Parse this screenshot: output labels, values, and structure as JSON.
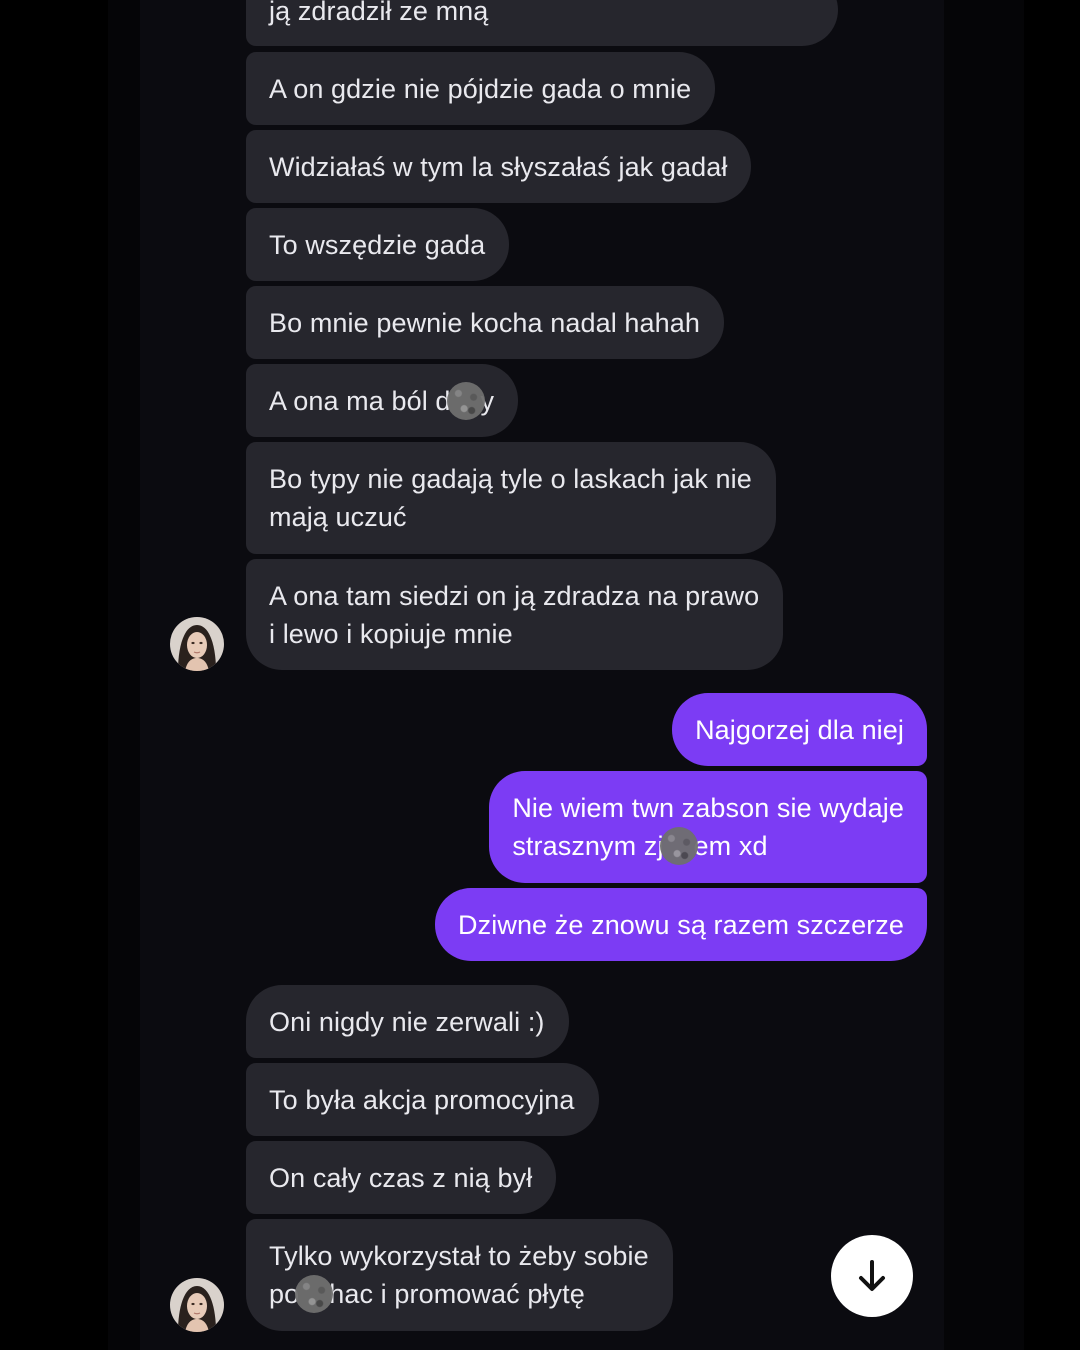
{
  "messages": {
    "m0": "ją zdradził ze mną",
    "m1": "A on gdzie nie pójdzie gada o mnie",
    "m2": "Widziałaś w tym la słyszałaś jak gadał",
    "m3": "To wszędzie gada",
    "m4": "Bo mnie pewnie kocha nadal hahah",
    "m5_a": "A ona ma ból d",
    "m5_b": "y",
    "m6_l1": "Bo typy nie gadają tyle o laskach jak nie",
    "m6_l2": "mają uczuć",
    "m7_l1": "A ona tam siedzi on ją zdradza na prawo",
    "m7_l2": "i lewo i kopiuje mnie",
    "o1": "Najgorzej dla niej",
    "o2_l1": "Nie wiem twn zabson sie wydaje",
    "o2_l2a": "strasznym zj",
    "o2_l2b": "em xd",
    "o3": "Dziwne że znowu są razem szczerze",
    "m8": "Oni nigdy nie zerwali :)",
    "m9": "To była akcja promocyjna",
    "m10": "On cały czas z nią był",
    "m11_l1": "Tylko wykorzystał to żeby sobie",
    "m11_l2a": "po",
    "m11_l2b": "hac i promować płytę"
  },
  "icons": {
    "avatar": "contact-avatar",
    "scroll_down": "arrow-down-icon",
    "redaction": "blur-redaction"
  },
  "colors": {
    "incoming_bubble": "#26262d",
    "outgoing_bubble": "#7c3cf4",
    "background": "#0b0b10"
  }
}
